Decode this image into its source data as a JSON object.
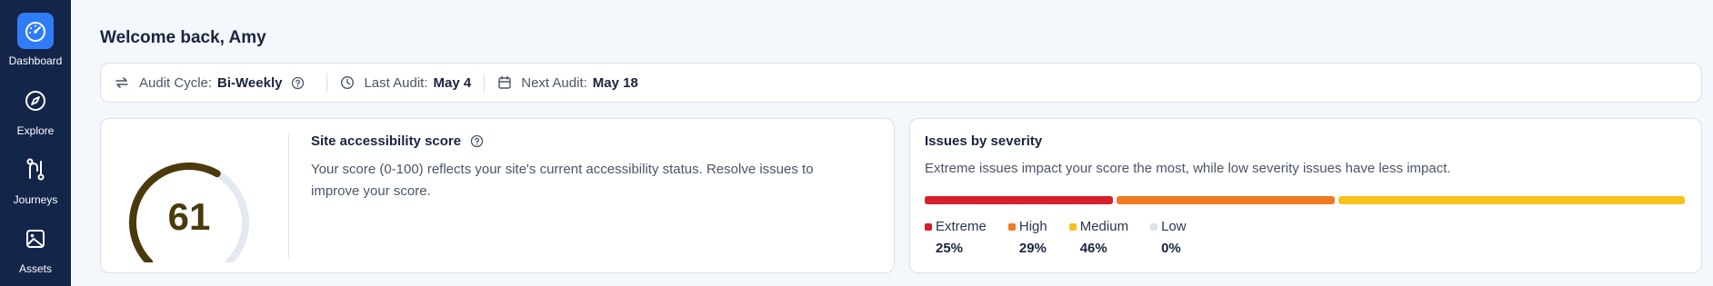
{
  "sidebar": {
    "items": [
      {
        "label": "Dashboard",
        "icon": "dashboard-gauge-icon",
        "active": true
      },
      {
        "label": "Explore",
        "icon": "compass-icon",
        "active": false
      },
      {
        "label": "Journeys",
        "icon": "route-icon",
        "active": false
      },
      {
        "label": "Assets",
        "icon": "image-icon",
        "active": false
      }
    ]
  },
  "header": {
    "welcome": "Welcome back, Amy"
  },
  "audit": {
    "cycle_label": "Audit Cycle:",
    "cycle_value": "Bi-Weekly",
    "last_label": "Last Audit:",
    "last_value": "May 4",
    "next_label": "Next Audit:",
    "next_value": "May 18"
  },
  "score_card": {
    "title": "Site accessibility score",
    "score": "61",
    "score_fraction": 0.61,
    "description": "Your score (0-100) reflects your site's current accessibility status. Resolve issues to improve your score."
  },
  "issues_card": {
    "title": "Issues by severity",
    "description": "Extreme issues impact your score the most, while low severity issues have less impact.",
    "severities": [
      {
        "name": "Extreme",
        "pct_label": "25%",
        "pct": 25,
        "color": "#d61f2a"
      },
      {
        "name": "High",
        "pct_label": "29%",
        "pct": 29,
        "color": "#f07a22"
      },
      {
        "name": "Medium",
        "pct_label": "46%",
        "pct": 46,
        "color": "#f6c31c"
      },
      {
        "name": "Low",
        "pct_label": "0%",
        "pct": 0,
        "color": "#dde3ec"
      }
    ]
  },
  "colors": {
    "sidebar_bg": "#14254a",
    "accent": "#2f7cf6",
    "gauge_fill": "#4a3a0c",
    "gauge_track": "#e4e8ef"
  }
}
